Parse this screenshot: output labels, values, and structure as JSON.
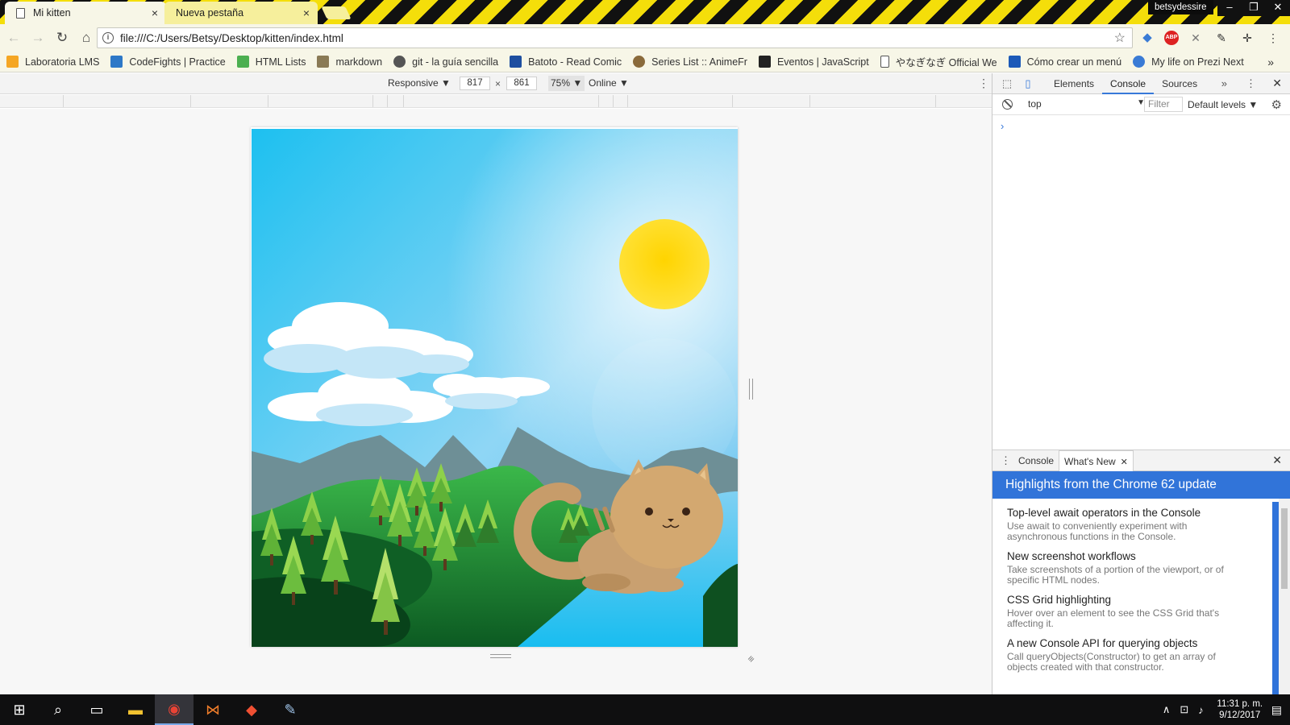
{
  "browser": {
    "tabs": [
      {
        "title": "Mi kitten",
        "close": "×"
      },
      {
        "title": "Nueva pestaña",
        "close": "×"
      }
    ],
    "profile_name": "betsydessire",
    "window_controls": {
      "minimize": "–",
      "restore": "❐",
      "close": "✕"
    },
    "url": "file:///C:/Users/Betsy/Desktop/kitten/index.html",
    "bookmarks": [
      {
        "label": "Laboratoria LMS",
        "icon": "laboratoria-icon",
        "color": "#f5a623"
      },
      {
        "label": "CodeFights | Practice",
        "icon": "codefights-icon",
        "color": "#2d78c7"
      },
      {
        "label": "HTML Lists",
        "icon": "w3schools-icon",
        "color": "#4caf50"
      },
      {
        "label": "markdown",
        "icon": "markdown-icon",
        "color": "#777777"
      },
      {
        "label": "git - la guía sencilla",
        "icon": "page-icon",
        "color": "#ffffff"
      },
      {
        "label": "Batoto - Read Comic",
        "icon": "batoto-icon",
        "color": "#1e4fa0"
      },
      {
        "label": "Series List :: AnimeFr",
        "icon": "animefr-icon",
        "color": "#8a6a3a"
      },
      {
        "label": "Eventos | JavaScript",
        "icon": "js-icon",
        "color": "#222222"
      },
      {
        "label": "やなぎなぎ Official We",
        "icon": "page-icon",
        "color": "#ffffff"
      },
      {
        "label": "Cómo crear un menú",
        "icon": "chart-icon",
        "color": "#1c5ab8"
      },
      {
        "label": "My life on Prezi Next",
        "icon": "prezi-icon",
        "color": "#3a7bd5"
      }
    ],
    "bookmarks_overflow": "»"
  },
  "device_toolbar": {
    "device": "Responsive ▼",
    "width": "817",
    "times": "×",
    "height": "861",
    "zoom": "75% ▼",
    "network": "Online ▼",
    "more": "⋮"
  },
  "devtools": {
    "tabs": [
      "Elements",
      "Console",
      "Sources"
    ],
    "active_tab": "Console",
    "more_tabs": "»",
    "context": "top",
    "filter_placeholder": "Filter",
    "levels": "Default levels ▼",
    "prompt": "›",
    "drawer_tabs": [
      "Console",
      "What's New"
    ],
    "whats_new": {
      "header": "Highlights from the Chrome 62 update",
      "items": [
        {
          "title": "Top-level await operators in the Console",
          "desc": "Use await to conveniently experiment with asynchronous functions in the Console."
        },
        {
          "title": "New screenshot workflows",
          "desc": "Take screenshots of a portion of the viewport, or of specific HTML nodes."
        },
        {
          "title": "CSS Grid highlighting",
          "desc": "Hover over an element to see the CSS Grid that's affecting it."
        },
        {
          "title": "A new Console API for querying objects",
          "desc": "Call queryObjects(Constructor) to get an array of objects created with that constructor."
        }
      ]
    }
  },
  "taskbar": {
    "time": "11:31 p. m.",
    "date": "9/12/2017"
  },
  "colors": {
    "sky_top": "#1dc0f0",
    "sun": "#ffd60a",
    "devtools_accent": "#3174d9",
    "cat": "#d3a870"
  }
}
